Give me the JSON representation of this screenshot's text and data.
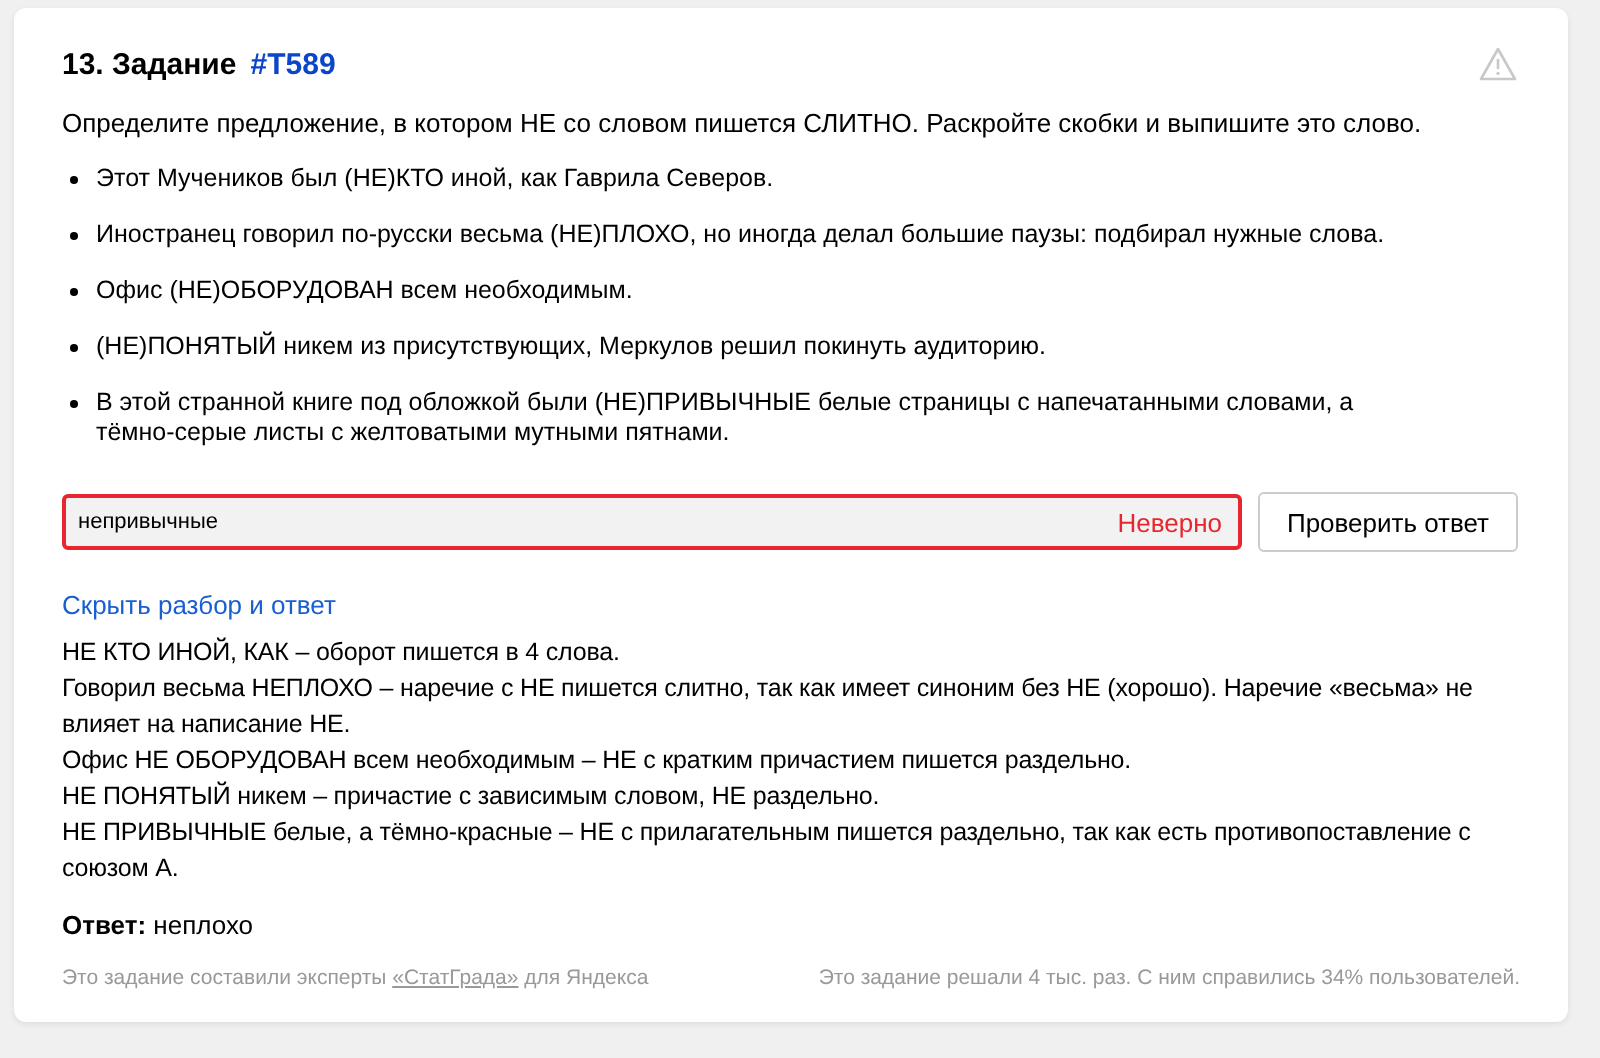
{
  "task": {
    "number": "13. Задание",
    "id_link": "#T589",
    "instruction": "Определите предложение, в котором НЕ со словом пишется СЛИТНО. Раскройте скобки и выпишите это слово.",
    "options": [
      "Этот Мучеников был (НЕ)КТО иной, как Гаврила Северов.",
      "Иностранец говорил по-русски весьма (НЕ)ПЛОХО, но иногда делал большие паузы: подбирал нужные слова.",
      "Офис (НЕ)ОБОРУДОВАН всем необходимым.",
      "(НЕ)ПОНЯТЫЙ никем из присутствующих, Меркулов решил покинуть аудиторию.",
      "В этой странной книге под обложкой были (НЕ)ПРИВЫЧНЫЕ белые страницы с напечатанными словами, а тёмно-серые листы с желтоватыми мутными пятнами."
    ]
  },
  "answer_field": {
    "value": "непривычные",
    "wrong": true,
    "verdict": "Неверно"
  },
  "check_button": "Проверить ответ",
  "toggle_link": "Скрыть разбор и ответ",
  "explanation": [
    "НЕ КТО ИНОЙ, КАК – оборот пишется в 4 слова.",
    "Говорил весьма НЕПЛОХО – наречие с НЕ пишется слитно, так как имеет синоним без НЕ (хорошо). Наречие «весьма» не влияет на написание НЕ.",
    "Офис НЕ ОБОРУДОВАН всем необходимым – НЕ с кратким причастием пишется раздельно.",
    "НЕ ПОНЯТЫЙ никем – причастие с зависимым словом, НЕ раздельно.",
    "НЕ ПРИВЫЧНЫЕ белые, а тёмно-красные – НЕ с прилагательным пишется раздельно, так как есть противопоставление с союзом А."
  ],
  "answer": "**Ответ:** неплохо",
  "footer": {
    "author_prefix": "Это задание составили эксперты",
    "author_link": "«СтатГрада»",
    "author_suffix": "для Яндекса",
    "stats": "Это задание решали 4 тыс. раз. С ним справились 34% пользователей."
  }
}
